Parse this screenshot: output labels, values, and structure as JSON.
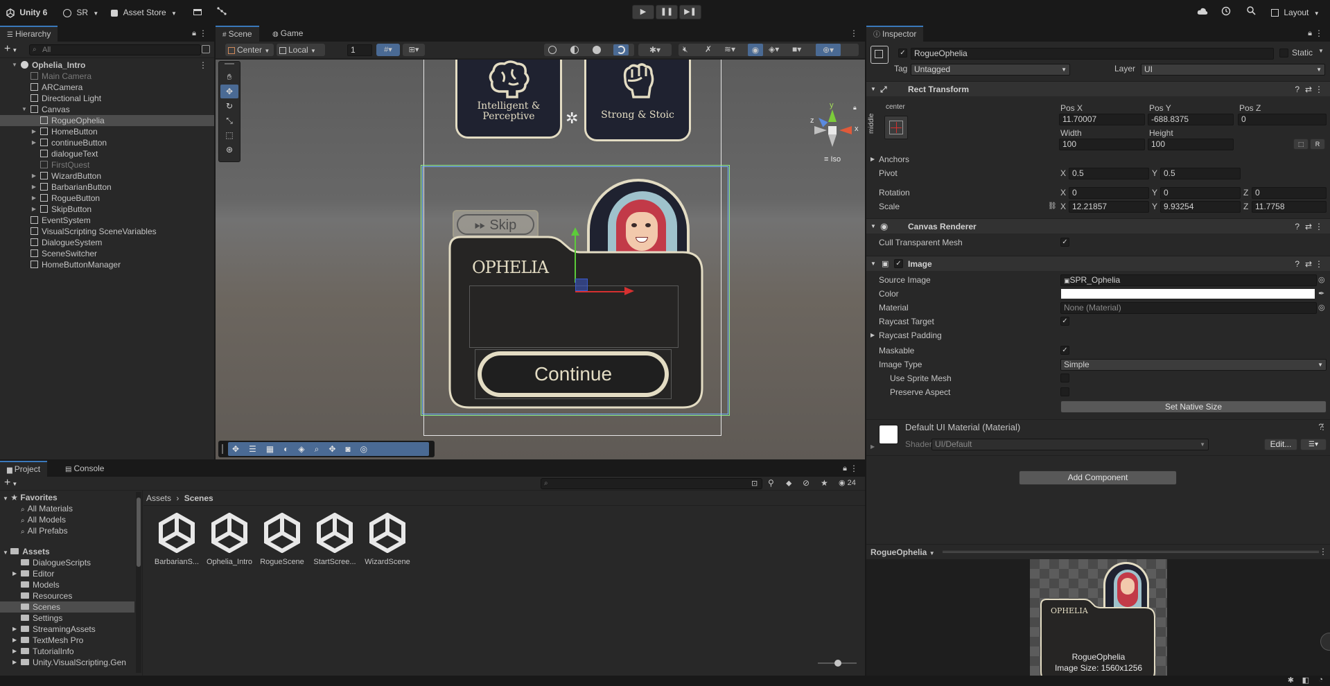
{
  "topbar": {
    "unity_label": "Unity 6",
    "account_label": "SR",
    "asset_store_label": "Asset Store",
    "layout_label": "Layout"
  },
  "hierarchy": {
    "tab_label": "Hierarchy",
    "search_placeholder": "All",
    "items": [
      {
        "label": "Ophelia_Intro",
        "depth": 0,
        "fold": "open",
        "icon": "scene-icon",
        "state": "bold"
      },
      {
        "label": "Main Camera",
        "depth": 1,
        "fold": "",
        "icon": "cube-icon",
        "state": "dim"
      },
      {
        "label": "ARCamera",
        "depth": 1,
        "fold": "",
        "icon": "cube-icon",
        "state": ""
      },
      {
        "label": "Directional Light",
        "depth": 1,
        "fold": "",
        "icon": "cube-icon",
        "state": ""
      },
      {
        "label": "Canvas",
        "depth": 1,
        "fold": "open",
        "icon": "cube-icon",
        "state": ""
      },
      {
        "label": "RogueOphelia",
        "depth": 2,
        "fold": "",
        "icon": "cube-icon",
        "state": "selected"
      },
      {
        "label": "HomeButton",
        "depth": 2,
        "fold": "closed",
        "icon": "cube-icon",
        "state": ""
      },
      {
        "label": "continueButton",
        "depth": 2,
        "fold": "closed",
        "icon": "cube-icon",
        "state": ""
      },
      {
        "label": "dialogueText",
        "depth": 2,
        "fold": "",
        "icon": "cube-icon",
        "state": ""
      },
      {
        "label": "FirstQuest",
        "depth": 2,
        "fold": "",
        "icon": "cube-icon",
        "state": "dim"
      },
      {
        "label": "WizardButton",
        "depth": 2,
        "fold": "closed",
        "icon": "cube-icon",
        "state": ""
      },
      {
        "label": "BarbarianButton",
        "depth": 2,
        "fold": "closed",
        "icon": "cube-icon",
        "state": ""
      },
      {
        "label": "RogueButton",
        "depth": 2,
        "fold": "closed",
        "icon": "cube-icon",
        "state": ""
      },
      {
        "label": "SkipButton",
        "depth": 2,
        "fold": "closed",
        "icon": "cube-icon",
        "state": ""
      },
      {
        "label": "EventSystem",
        "depth": 1,
        "fold": "",
        "icon": "cube-icon",
        "state": ""
      },
      {
        "label": "VisualScripting SceneVariables",
        "depth": 1,
        "fold": "",
        "icon": "cube-icon",
        "state": ""
      },
      {
        "label": "DialogueSystem",
        "depth": 1,
        "fold": "",
        "icon": "cube-icon",
        "state": ""
      },
      {
        "label": "SceneSwitcher",
        "depth": 1,
        "fold": "",
        "icon": "cube-icon",
        "state": ""
      },
      {
        "label": "HomeButtonManager",
        "depth": 1,
        "fold": "",
        "icon": "cube-icon",
        "state": ""
      }
    ]
  },
  "scene": {
    "tabs": [
      {
        "label": "Scene"
      },
      {
        "label": "Game"
      }
    ],
    "pivot_mode": "Center",
    "space_mode": "Local",
    "grid_value": "1",
    "iso_label": "Iso",
    "gizmo": {
      "y": "y",
      "x": "x",
      "z": "z"
    },
    "cards": [
      {
        "label": "Intelligent &\nPerceptive"
      },
      {
        "label": "Strong & Stoic"
      }
    ],
    "skip_label": "Skip",
    "name_label": "OPHELIA",
    "continue_label": "Continue"
  },
  "inspector": {
    "tab_label": "Inspector",
    "object_name": "RogueOphelia",
    "static_label": "Static",
    "tag_label": "Tag",
    "tag_value": "Untagged",
    "layer_label": "Layer",
    "layer_value": "UI",
    "rect_transform": {
      "title": "Rect Transform",
      "anchor_h": "center",
      "anchor_v": "middle",
      "posx_label": "Pos X",
      "posx": "11.70007",
      "posy_label": "Pos Y",
      "posy": "-688.8375",
      "posz_label": "Pos Z",
      "posz": "0",
      "width_label": "Width",
      "width": "100",
      "height_label": "Height",
      "height": "100",
      "anchors_label": "Anchors",
      "pivot_label": "Pivot",
      "pivot_x": "0.5",
      "pivot_y": "0.5",
      "rotation_label": "Rotation",
      "rot_x": "0",
      "rot_y": "0",
      "rot_z": "0",
      "scale_label": "Scale",
      "scale_x": "12.21857",
      "scale_y": "9.93254",
      "scale_z": "11.7758",
      "x": "X",
      "y": "Y",
      "z": "Z",
      "r_button": "R"
    },
    "canvas_renderer": {
      "title": "Canvas Renderer",
      "cull_label": "Cull Transparent Mesh"
    },
    "image": {
      "title": "Image",
      "source_label": "Source Image",
      "source_value": "SPR_Ophelia",
      "color_label": "Color",
      "material_label": "Material",
      "material_value": "None (Material)",
      "raycast_label": "Raycast Target",
      "raycast_padding_label": "Raycast Padding",
      "maskable_label": "Maskable",
      "image_type_label": "Image Type",
      "image_type_value": "Simple",
      "sprite_mesh_label": "Use Sprite Mesh",
      "preserve_label": "Preserve Aspect",
      "native_size_label": "Set Native Size"
    },
    "material": {
      "title": "Default UI Material (Material)",
      "shader_label": "Shader",
      "shader_value": "UI/Default",
      "edit_label": "Edit..."
    },
    "add_component_label": "Add Component",
    "preview": {
      "dropdown_label": "RogueOphelia",
      "name": "RogueOphelia",
      "size": "Image Size: 1560x1256",
      "banner": "OPHELIA"
    }
  },
  "project": {
    "tabs": [
      {
        "label": "Project"
      },
      {
        "label": "Console"
      }
    ],
    "count": "24",
    "favorites_label": "Favorites",
    "favorites": [
      "All Materials",
      "All Models",
      "All Prefabs"
    ],
    "assets_label": "Assets",
    "folders": [
      {
        "label": "DialogueScripts",
        "fold": false
      },
      {
        "label": "Editor",
        "fold": true
      },
      {
        "label": "Models",
        "fold": false
      },
      {
        "label": "Resources",
        "fold": false
      },
      {
        "label": "Scenes",
        "fold": false,
        "selected": true
      },
      {
        "label": "Settings",
        "fold": false
      },
      {
        "label": "StreamingAssets",
        "fold": true
      },
      {
        "label": "TextMesh Pro",
        "fold": true
      },
      {
        "label": "TutorialInfo",
        "fold": true
      },
      {
        "label": "Unity.VisualScripting.Gen",
        "fold": true
      }
    ],
    "breadcrumb": [
      "Assets",
      "Scenes"
    ],
    "scene_assets": [
      {
        "label": "BarbarianS..."
      },
      {
        "label": "Ophelia_Intro"
      },
      {
        "label": "RogueScene"
      },
      {
        "label": "StartScree..."
      },
      {
        "label": "WizardScene"
      }
    ]
  },
  "colors": {
    "accent": "#3a79bb",
    "selection": "#4d4d4d",
    "panel": "#282828",
    "card": "#1f2230",
    "card_border": "#e3dcc3"
  }
}
